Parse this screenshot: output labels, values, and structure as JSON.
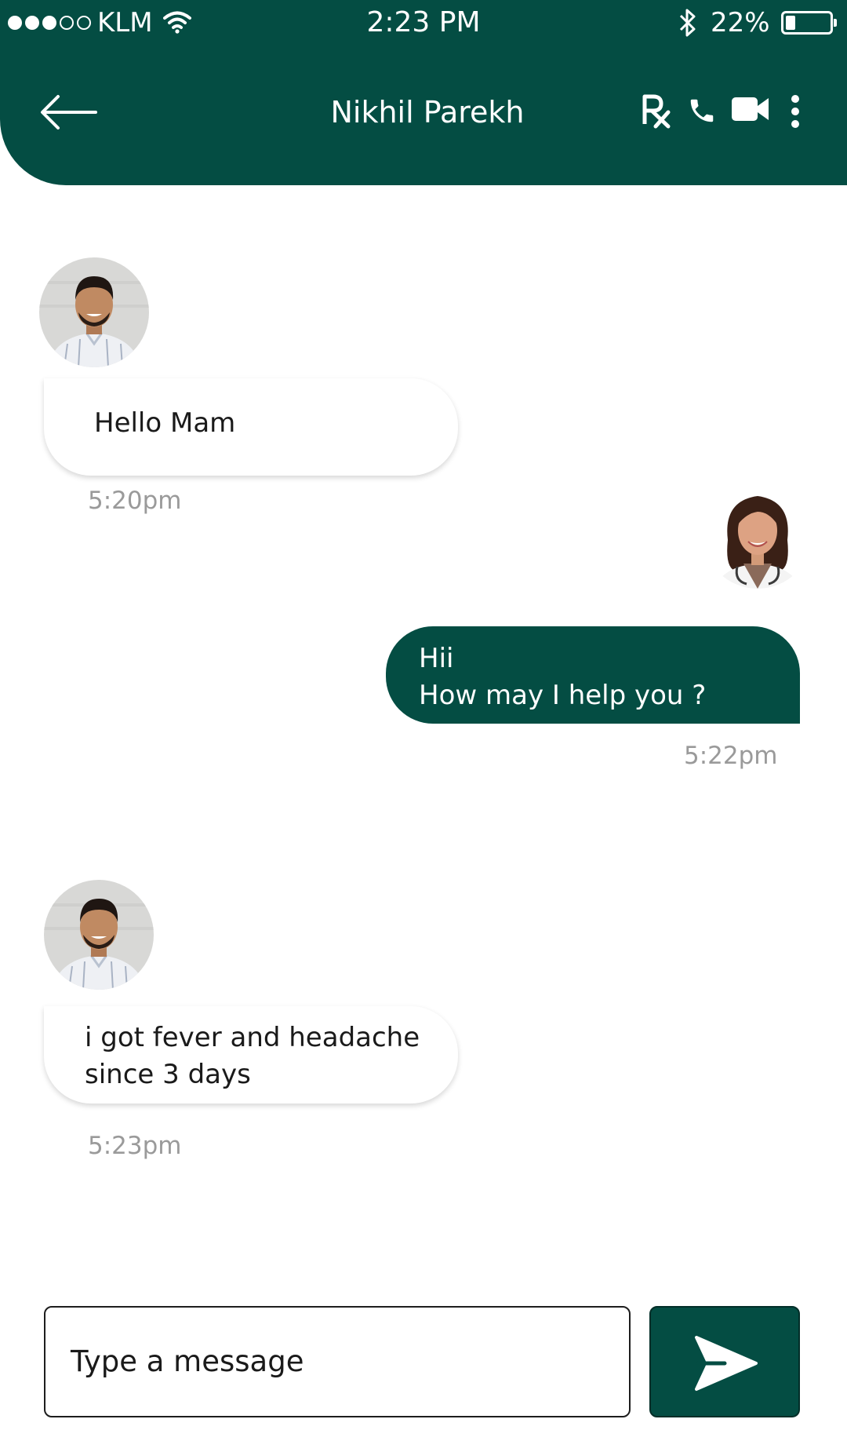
{
  "status_bar": {
    "carrier": "KLM",
    "time": "2:23 PM",
    "battery_percent": "22%",
    "battery_level": 0.22,
    "signal_bars_total": 5,
    "signal_bars_filled": 3
  },
  "header": {
    "back_icon": "arrow-left-icon",
    "contact_name": "Nikhil Parekh",
    "actions": [
      {
        "name": "prescription",
        "icon": "rx-icon"
      },
      {
        "name": "voice-call",
        "icon": "phone-icon"
      },
      {
        "name": "video-call",
        "icon": "video-camera-icon"
      },
      {
        "name": "more-options",
        "icon": "more-vertical-icon"
      }
    ]
  },
  "messages": [
    {
      "direction": "incoming",
      "sender_avatar": "patient-avatar",
      "lines": [
        "Hello Mam"
      ],
      "time": "5:20pm"
    },
    {
      "direction": "outgoing",
      "sender_avatar": "doctor-avatar",
      "lines": [
        "Hii",
        "How may I help you ?"
      ],
      "time": "5:22pm"
    },
    {
      "direction": "incoming",
      "sender_avatar": "patient-avatar",
      "lines": [
        "i got fever and headache",
        "since 3 days"
      ],
      "time": "5:23pm"
    }
  ],
  "composer": {
    "placeholder": "Type a message",
    "send_icon": "send-icon"
  },
  "colors": {
    "primary": "#044d43",
    "background": "#ffffff",
    "timestamp": "#9a9a9a",
    "incoming_bubble": "#ffffff",
    "outgoing_bubble": "#044d43"
  }
}
